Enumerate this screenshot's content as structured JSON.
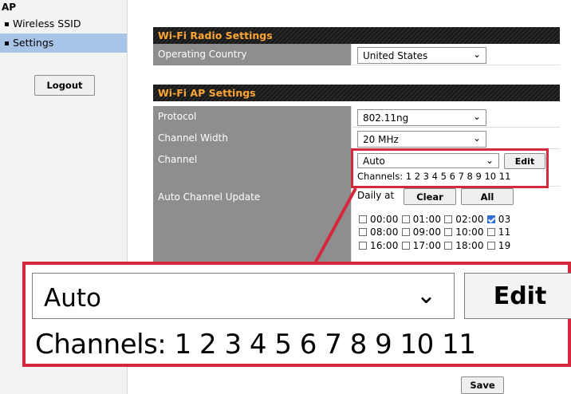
{
  "sidebar": {
    "title": "AP",
    "items": [
      {
        "label": "Wireless SSID"
      },
      {
        "label": "Settings"
      }
    ],
    "logout_label": "Logout"
  },
  "radio": {
    "heading": "Wi-Fi Radio Settings",
    "operating_country_label": "Operating Country",
    "operating_country_value": "United States"
  },
  "ap": {
    "heading": "Wi-Fi AP Settings",
    "protocol_label": "Protocol",
    "protocol_value": "802.11ng",
    "channel_width_label": "Channel Width",
    "channel_width_value": "20 MHz",
    "channel_label": "Channel",
    "channel_value": "Auto",
    "edit_label": "Edit",
    "channels_text": "Channels: 1 2 3 4 5 6 7 8 9 10 11",
    "auto_update_label": "Auto Channel Update",
    "daily_at": "Daily at",
    "clear_label": "Clear",
    "all_label": "All",
    "hours": [
      [
        {
          "t": "00:00",
          "on": false
        },
        {
          "t": "01:00",
          "on": false
        },
        {
          "t": "02:00",
          "on": false
        },
        {
          "t": "03",
          "on": true
        }
      ],
      [
        {
          "t": "08:00",
          "on": false
        },
        {
          "t": "09:00",
          "on": false
        },
        {
          "t": "10:00",
          "on": false
        },
        {
          "t": "11",
          "on": false
        }
      ],
      [
        {
          "t": "16:00",
          "on": false
        },
        {
          "t": "17:00",
          "on": false
        },
        {
          "t": "18:00",
          "on": false
        },
        {
          "t": "19",
          "on": false
        }
      ]
    ]
  },
  "zoom": {
    "channel_value": "Auto",
    "edit_label": "Edit",
    "channels_text": "Channels: 1 2 3 4 5 6 7 8 9 10 11"
  },
  "save_label": "Save",
  "colors": {
    "highlight": "#d6283c",
    "heading_text": "#ffa533",
    "selected_nav": "#a8c4e6",
    "label_bg": "#8e8e8e"
  }
}
